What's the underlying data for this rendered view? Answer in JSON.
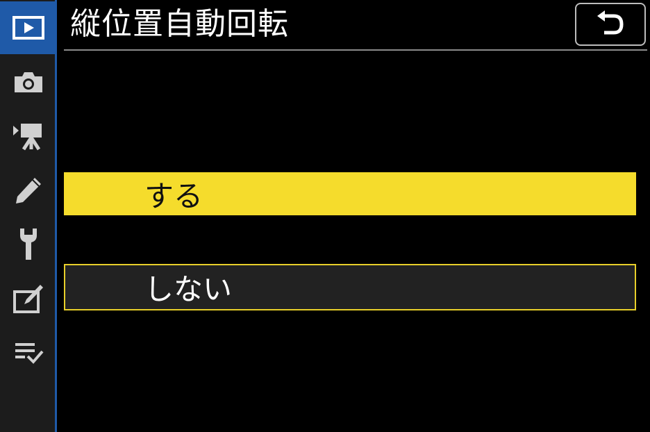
{
  "header": {
    "title": "縦位置自動回転"
  },
  "back_button": {
    "icon": "return-arrow-icon"
  },
  "sidebar": {
    "tabs": [
      {
        "name": "playback-menu",
        "icon": "playback-icon",
        "active": true
      },
      {
        "name": "photo-shooting-menu",
        "icon": "camera-icon",
        "active": false
      },
      {
        "name": "movie-shooting-menu",
        "icon": "movie-camera-icon",
        "active": false
      },
      {
        "name": "custom-settings-menu",
        "icon": "pencil-icon",
        "active": false
      },
      {
        "name": "setup-menu",
        "icon": "wrench-icon",
        "active": false
      },
      {
        "name": "retouch-menu",
        "icon": "retouch-icon",
        "active": false
      },
      {
        "name": "my-menu",
        "icon": "list-check-icon",
        "active": false
      }
    ]
  },
  "options": [
    {
      "label": "する",
      "selected": true
    },
    {
      "label": "しない",
      "selected": false
    }
  ],
  "colors": {
    "highlight": "#f5dc2c",
    "active_tab": "#1f5aa8",
    "background": "#000000"
  }
}
